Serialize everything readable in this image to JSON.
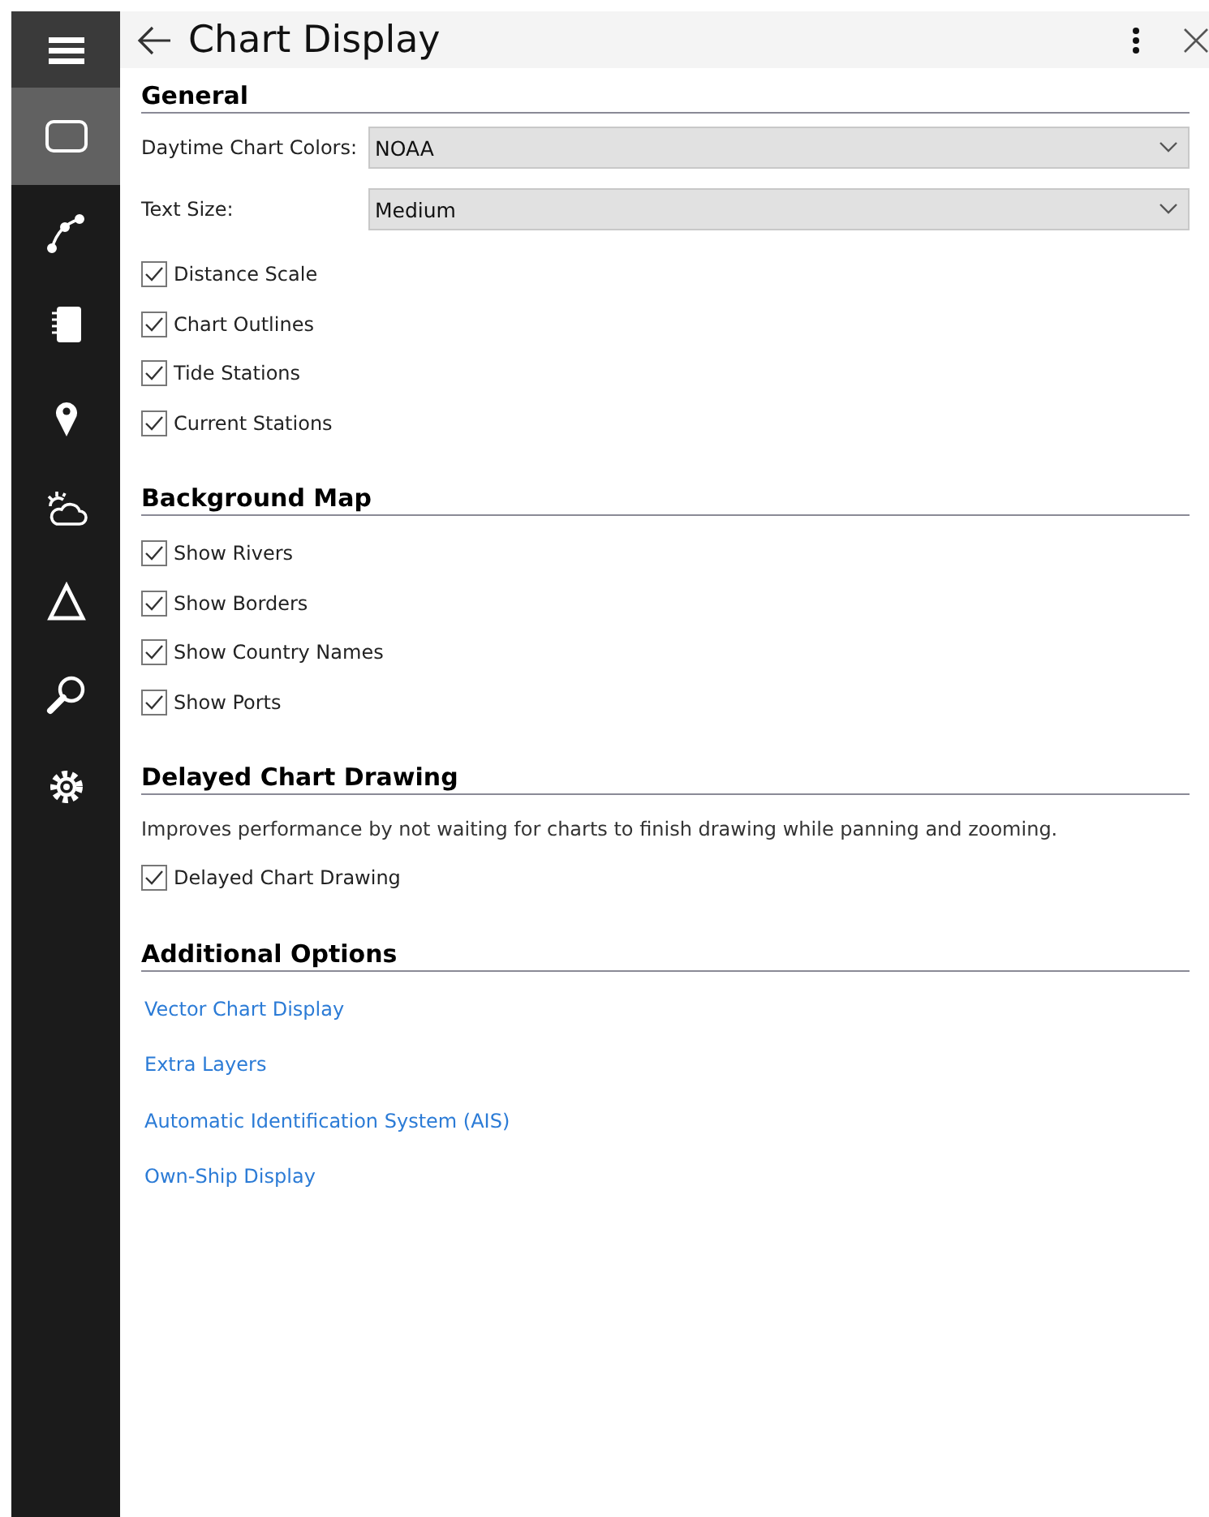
{
  "rail": {
    "items": [
      {
        "selected": false
      },
      {
        "selected": true
      },
      {
        "selected": false
      },
      {
        "selected": false
      },
      {
        "selected": false
      },
      {
        "selected": false
      },
      {
        "selected": false
      },
      {
        "selected": false
      },
      {
        "selected": false
      }
    ]
  },
  "header": {
    "title": "Chart Display"
  },
  "sections": [
    {
      "title": "General",
      "fields": [
        {
          "label": "Daytime Chart Colors:",
          "value": "NOAA"
        },
        {
          "label": "Text Size:",
          "value": "Medium"
        }
      ],
      "checkboxes": [
        {
          "label": "Distance Scale",
          "checked": true
        },
        {
          "label": "Chart Outlines",
          "checked": true
        },
        {
          "label": "Tide Stations",
          "checked": true
        },
        {
          "label": "Current Stations",
          "checked": true
        }
      ]
    },
    {
      "title": "Background Map",
      "checkboxes": [
        {
          "label": "Show Rivers",
          "checked": true
        },
        {
          "label": "Show Borders",
          "checked": true
        },
        {
          "label": "Show Country Names",
          "checked": true
        },
        {
          "label": "Show Ports",
          "checked": true
        }
      ]
    },
    {
      "title": "Delayed Chart Drawing",
      "description": "Improves performance by not waiting for charts to finish drawing while panning and zooming.",
      "checkboxes": [
        {
          "label": "Delayed Chart Drawing",
          "checked": true
        }
      ]
    },
    {
      "title": "Additional Options",
      "links": [
        "Vector Chart Display",
        "Extra Layers",
        "Automatic Identification System (AIS)",
        "Own-Ship Display"
      ]
    }
  ]
}
